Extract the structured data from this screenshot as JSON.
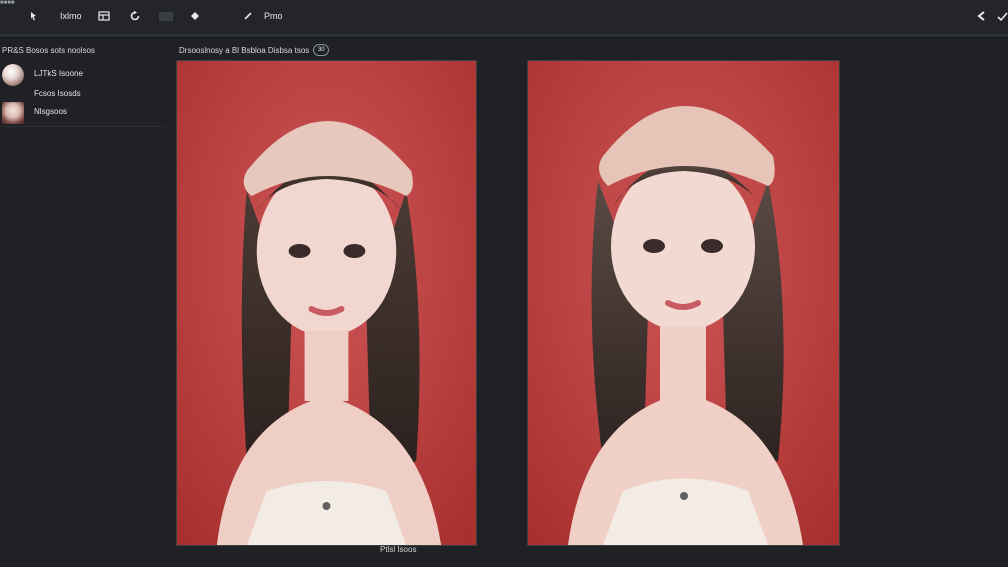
{
  "app": {
    "label": "■■■■"
  },
  "toolbar": {
    "labels": {
      "library": "Ixlmo",
      "paste": "Pmo"
    },
    "icons": {
      "pointer": "pointer-icon",
      "layout": "layout-icon",
      "rotate": "rotate-icon",
      "diamond": "diamond-icon",
      "brush": "brush-icon",
      "back": "back-arrow-icon",
      "check": "check-icon"
    }
  },
  "sidebar": {
    "title": "PR&S Bosos sots noolsos",
    "items": [
      {
        "label": "LJTkS Isoone"
      },
      {
        "label": "Fcsos Isosds"
      },
      {
        "label": "Nlsgsoos"
      }
    ]
  },
  "main": {
    "header": "Drsooslnosy a Bl Bsbloa Disbsa tsos",
    "count": "30",
    "footer": "Ptlsl Isoos"
  },
  "colors": {
    "background": "#1f2124",
    "image_backdrop": "#b23a3a",
    "accent_text": "#d7d9dc"
  }
}
